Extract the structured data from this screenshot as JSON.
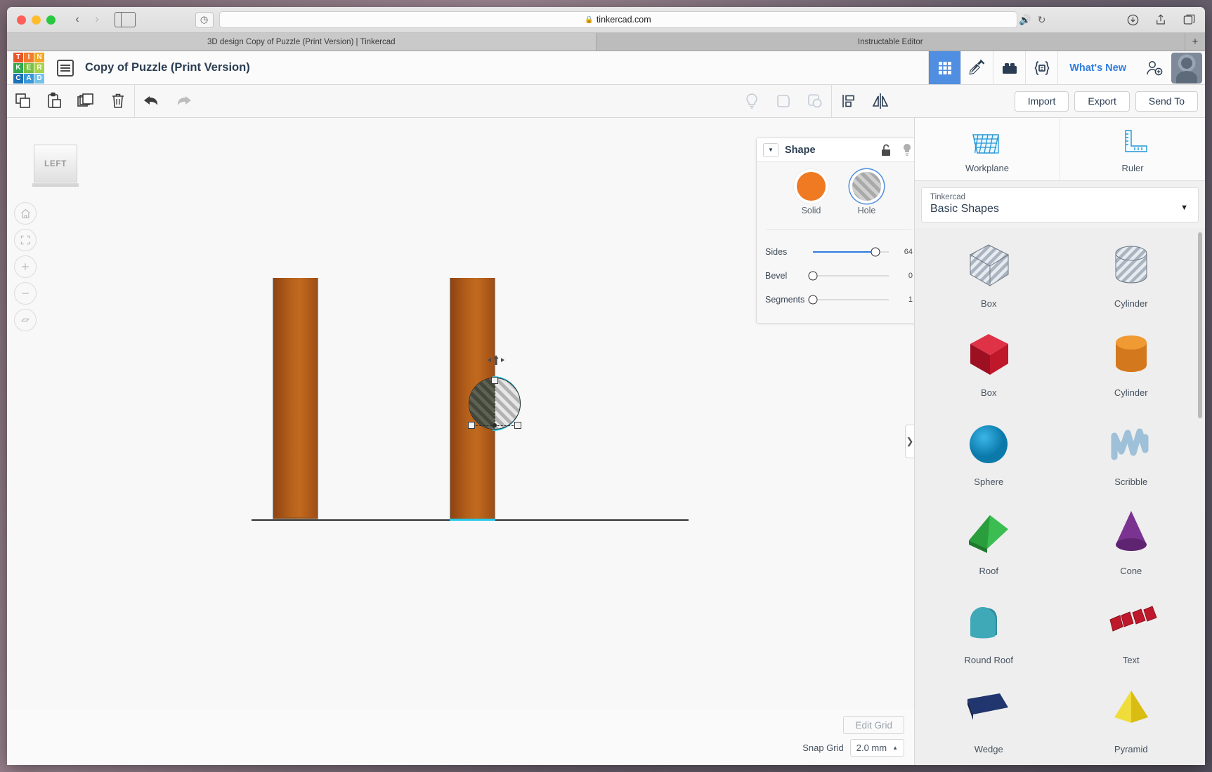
{
  "browser": {
    "url": "tinkercad.com",
    "lock_icon": "lock-icon",
    "tabs": [
      {
        "title": "3D design Copy of Puzzle (Print Version) | Tinkercad",
        "active": true
      },
      {
        "title": "Instructable Editor",
        "active": false
      }
    ],
    "new_tab_label": "+"
  },
  "header": {
    "logo_letters": [
      "T",
      "I",
      "N",
      "K",
      "E",
      "R",
      "C",
      "A",
      "D"
    ],
    "document_title": "Copy of Puzzle (Print Version)",
    "whats_new_label": "What's New",
    "icons": [
      {
        "name": "grid-view-icon",
        "active": true
      },
      {
        "name": "codeblocks-hammer-icon",
        "active": false
      },
      {
        "name": "blocks-brick-icon",
        "active": false
      },
      {
        "name": "code-braces-icon",
        "active": false
      }
    ]
  },
  "toolbar": {
    "left_icons": [
      "copy-icon",
      "paste-icon",
      "duplicate-icon",
      "delete-icon",
      "undo-icon",
      "redo-icon"
    ],
    "mid_icons": [
      "lightbulb-icon",
      "group-icon",
      "ungroup-icon",
      "align-icon",
      "mirror-icon"
    ],
    "import_label": "Import",
    "export_label": "Export",
    "send_to_label": "Send To"
  },
  "canvas": {
    "view_cube_label": "LEFT",
    "view_buttons": [
      "home-icon",
      "fit-all-icon",
      "zoom-in-icon",
      "zoom-out-icon",
      "ortho-perspective-icon"
    ],
    "collapse_arrow": "❯"
  },
  "inspector": {
    "title": "Shape",
    "lock_icon": "unlock-icon",
    "light_icon": "lightbulb-icon",
    "caret": "▼",
    "modes": [
      {
        "label": "Solid",
        "selected": false,
        "color": "#ef7a22"
      },
      {
        "label": "Hole",
        "selected": true,
        "color": "#b8b8b8"
      }
    ],
    "sliders": [
      {
        "label": "Sides",
        "value": "64",
        "fill_pct": 82
      },
      {
        "label": "Bevel",
        "value": "0",
        "fill_pct": 0
      },
      {
        "label": "Segments",
        "value": "1",
        "fill_pct": 0
      }
    ]
  },
  "sidebar": {
    "tools": [
      {
        "label": "Workplane",
        "icon": "workplane-icon"
      },
      {
        "label": "Ruler",
        "icon": "ruler-icon"
      }
    ],
    "library": {
      "owner": "Tinkercad",
      "collection": "Basic Shapes",
      "caret": "▼"
    },
    "shapes": [
      {
        "label": "Box",
        "kind": "box-hole",
        "color": "#b9c2cc"
      },
      {
        "label": "Cylinder",
        "kind": "cylinder-hole",
        "color": "#b9c2cc"
      },
      {
        "label": "Box",
        "kind": "box",
        "color": "#c0182b"
      },
      {
        "label": "Cylinder",
        "kind": "cylinder",
        "color": "#e08a22"
      },
      {
        "label": "Sphere",
        "kind": "sphere",
        "color": "#0e8ec4"
      },
      {
        "label": "Scribble",
        "kind": "scribble",
        "color": "#9ec0d8"
      },
      {
        "label": "Roof",
        "kind": "roof",
        "color": "#2e9e3e"
      },
      {
        "label": "Cone",
        "kind": "cone",
        "color": "#7b3391"
      },
      {
        "label": "Round Roof",
        "kind": "round-roof",
        "color": "#3fb6c4"
      },
      {
        "label": "Text",
        "kind": "text",
        "color": "#c0182b"
      },
      {
        "label": "Wedge",
        "kind": "wedge",
        "color": "#21356e"
      },
      {
        "label": "Pyramid",
        "kind": "pyramid",
        "color": "#e2c918"
      }
    ]
  },
  "footer": {
    "edit_grid_label": "Edit Grid",
    "snap_grid_label": "Snap Grid",
    "snap_grid_value": "2.0 mm",
    "snap_caret": "▲"
  }
}
